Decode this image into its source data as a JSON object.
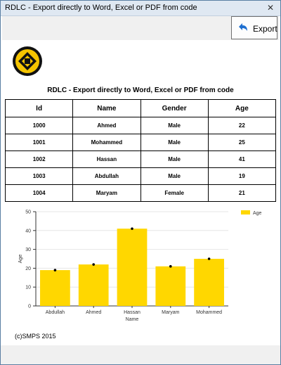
{
  "window": {
    "title": "RDLC - Export directly to Word, Excel or PDF from code",
    "close_glyph": "✕"
  },
  "toolbar": {
    "export_label": "Export",
    "export_icon": "undo-arrow-icon"
  },
  "report": {
    "title": "RDLC - Export directly to Word, Excel or PDF from code",
    "logo": "logo-icon",
    "table": {
      "columns": [
        "Id",
        "Name",
        "Gender",
        "Age"
      ],
      "rows": [
        [
          "1000",
          "Ahmed",
          "Male",
          "22"
        ],
        [
          "1001",
          "Mohammed",
          "Male",
          "25"
        ],
        [
          "1002",
          "Hassan",
          "Male",
          "41"
        ],
        [
          "1003",
          "Abdullah",
          "Male",
          "19"
        ],
        [
          "1004",
          "Maryam",
          "Female",
          "21"
        ]
      ]
    },
    "footer": "(c)SMPS 2015"
  },
  "colors": {
    "bar": "#ffd700",
    "accent": "#1e6fd0",
    "logo_yellow": "#f5c400"
  },
  "chart_data": {
    "type": "bar",
    "categories": [
      "Abdullah",
      "Ahmed",
      "Hassan",
      "Maryam",
      "Mohammed"
    ],
    "series": [
      {
        "name": "Age",
        "values": [
          19,
          22,
          41,
          21,
          25
        ]
      }
    ],
    "xlabel": "Name",
    "ylabel": "Age",
    "ylim": [
      0,
      50
    ],
    "yticks": [
      0,
      10,
      20,
      30,
      40,
      50
    ],
    "grid": true,
    "legend": "top-right"
  }
}
